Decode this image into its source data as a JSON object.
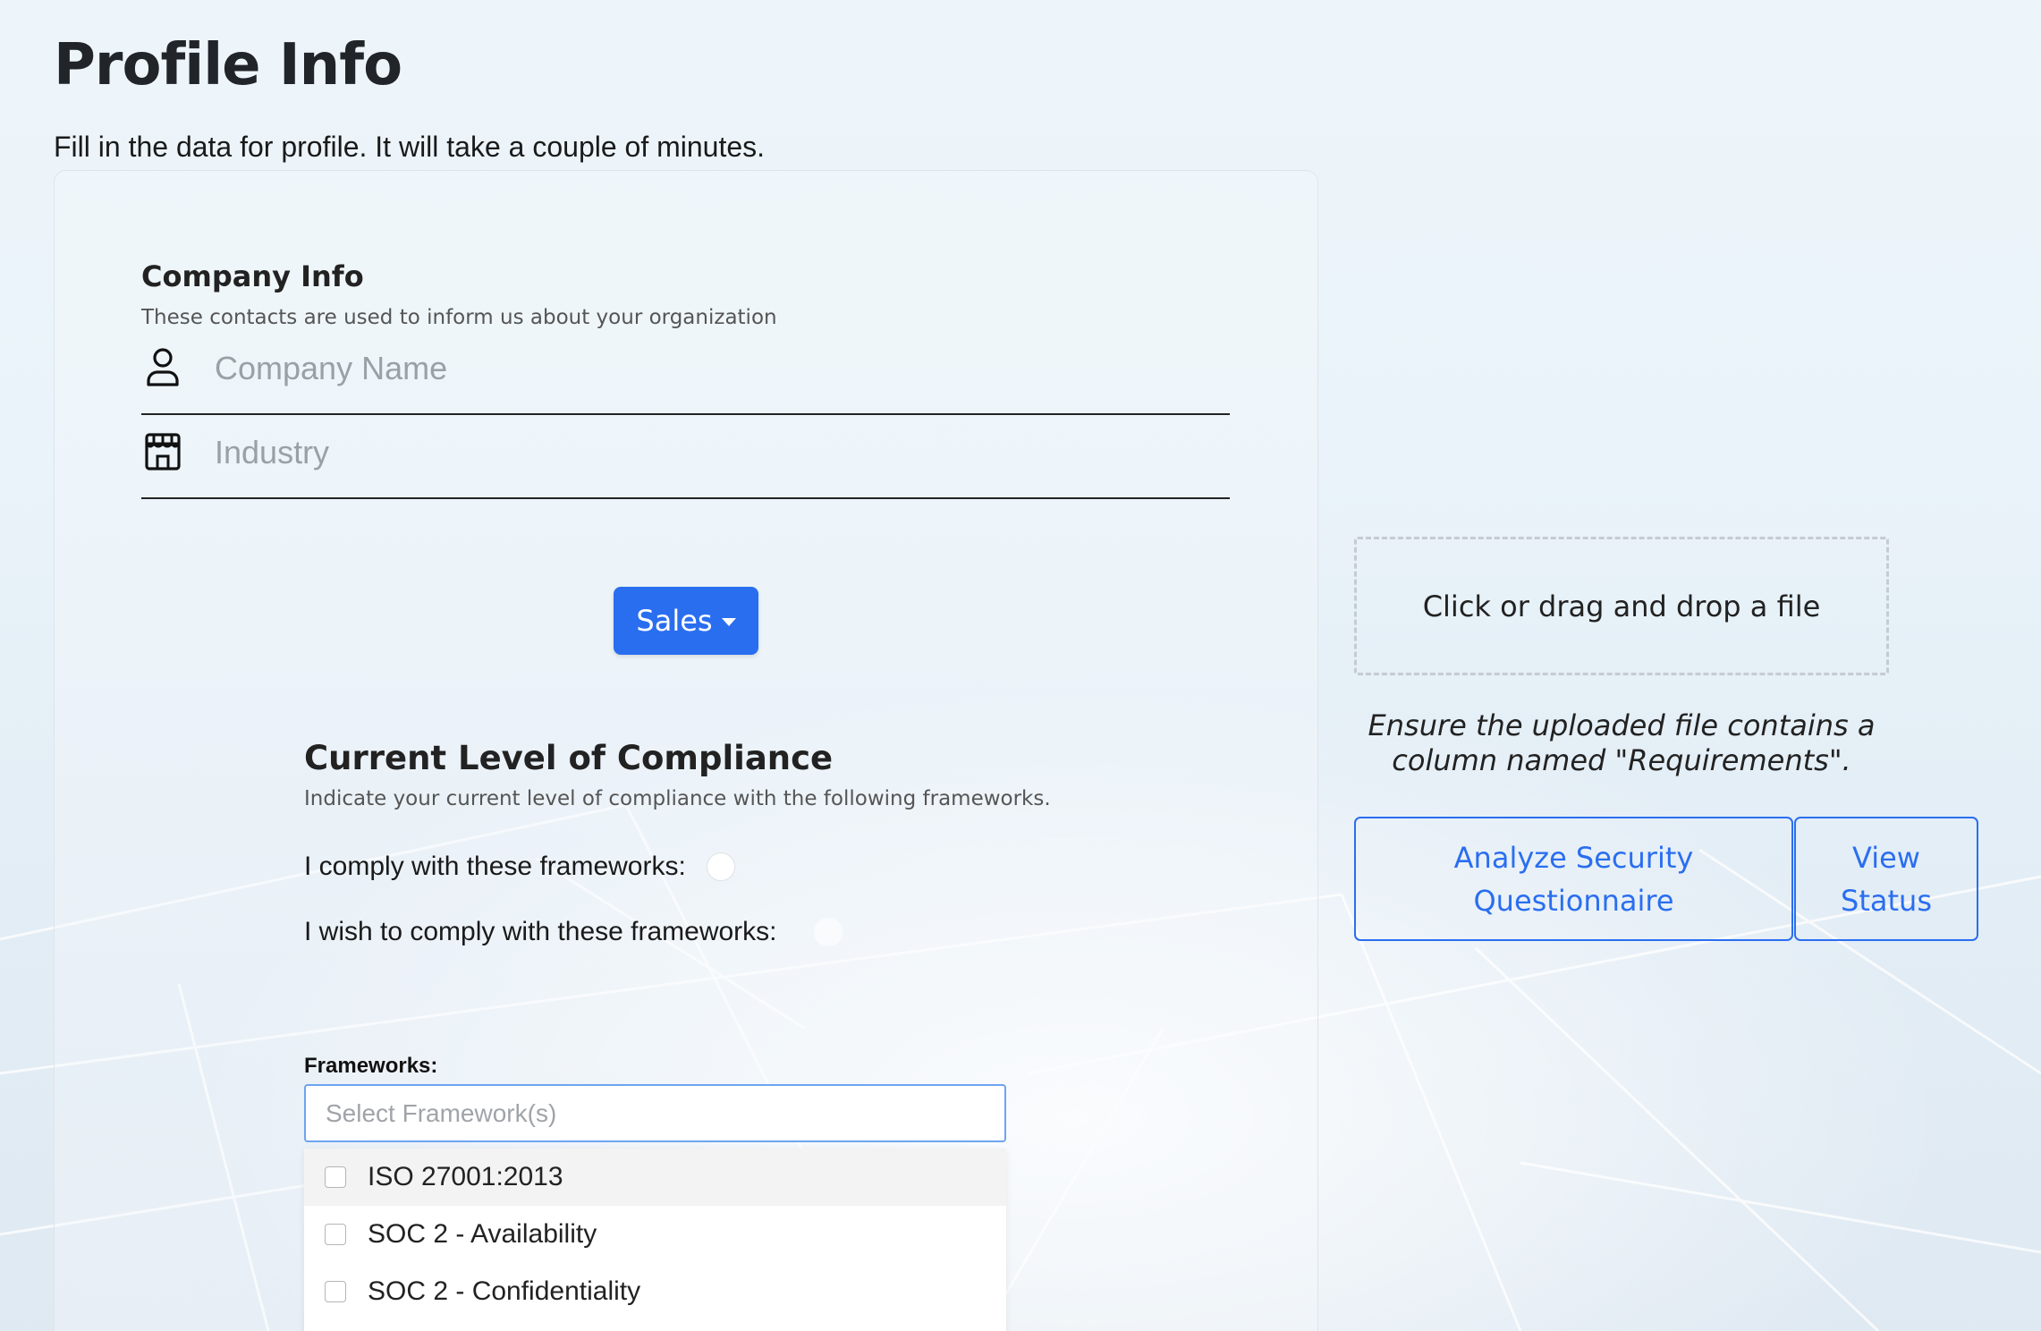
{
  "page": {
    "title": "Profile Info",
    "subtitle": "Fill in the data for profile. It will take a couple of minutes."
  },
  "company_info": {
    "title": "Company Info",
    "description": "These contacts are used to inform us about your organization",
    "company_name_placeholder": "Company Name",
    "company_name_value": "",
    "company_name_icon": "person-icon",
    "industry_placeholder": "Industry",
    "industry_value": "",
    "industry_icon": "building-icon"
  },
  "department_dropdown": {
    "selected": "Sales",
    "accent_color": "#2a6ef0"
  },
  "compliance": {
    "title": "Current Level of Compliance",
    "description": "Indicate your current level of compliance with the following frameworks.",
    "option_comply": "I comply with these frameworks:",
    "option_wish": "I wish to comply with these frameworks:"
  },
  "frameworks": {
    "label": "Frameworks:",
    "placeholder": "Select Framework(s)",
    "options": [
      "ISO 27001:2013",
      "SOC 2 - Availability",
      "SOC 2 - Confidentiality"
    ]
  },
  "upload": {
    "dropzone_text": "Click or drag and drop a file",
    "note": "Ensure the uploaded file contains a column named \"Requirements\".",
    "analyze_button": "Analyze Security Questionnaire",
    "status_button": "View Status"
  }
}
